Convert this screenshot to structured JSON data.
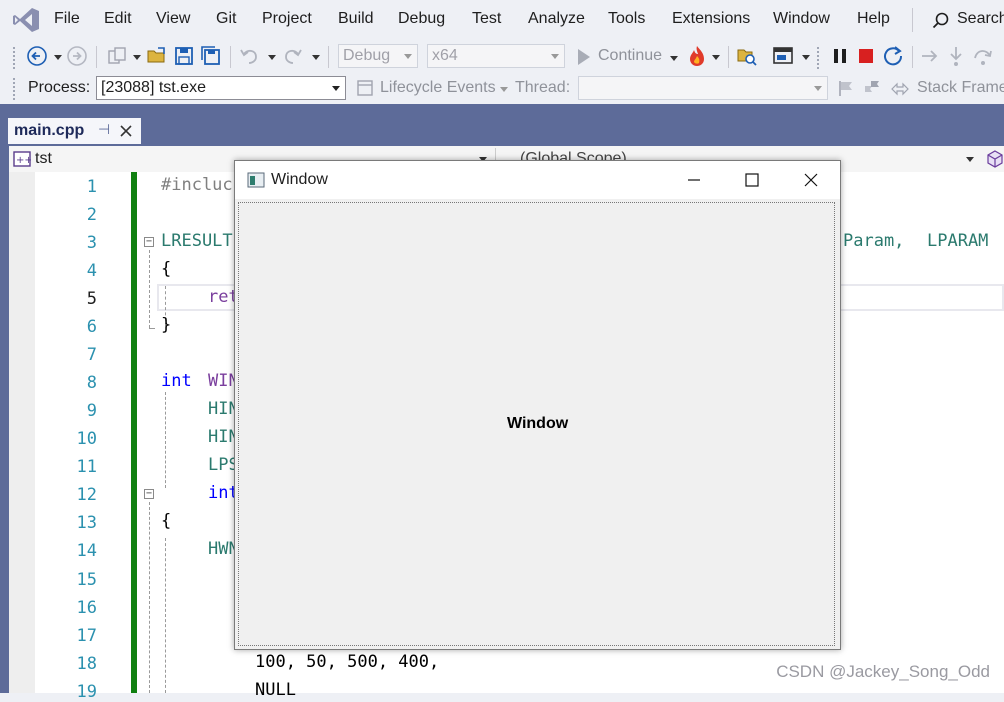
{
  "menu": {
    "items": [
      "File",
      "Edit",
      "View",
      "Git",
      "Project",
      "Build",
      "Debug",
      "Test",
      "Analyze",
      "Tools",
      "Extensions",
      "Window",
      "Help"
    ],
    "search_label": "Search"
  },
  "toolbar": {
    "config_value": "Debug",
    "platform_value": "x64",
    "continue_label": "Continue"
  },
  "process_bar": {
    "process_label": "Process:",
    "process_value": "[23088] tst.exe",
    "lifecycle_label": "Lifecycle Events",
    "thread_label": "Thread:",
    "stack_frame_label": "Stack Frame"
  },
  "tab": {
    "title": "main.cpp"
  },
  "editor_header": {
    "project_value": "tst",
    "scope_value": "(Global Scope)"
  },
  "editor": {
    "line_numbers": [
      "1",
      "2",
      "3",
      "4",
      "5",
      "6",
      "7",
      "8",
      "9",
      "10",
      "11",
      "12",
      "13",
      "14",
      "15",
      "16",
      "17",
      "18",
      "19"
    ],
    "current_line": "5",
    "lines": {
      "l1": "#incluc",
      "l3a": "LRESULT",
      "l3b": "Param, ",
      "l3c": "LPARAM",
      "l4": "{",
      "l5": "ret",
      "l6": "}",
      "l8a": "int",
      "l8b": "WIN",
      "l9": "HIN",
      "l10": "HIN",
      "l11": "LPS",
      "l12": "int",
      "l13": "{",
      "l14": "HWN",
      "l18": "100, 50, 500, 400,",
      "l19": "NULL"
    }
  },
  "app_window": {
    "title": "Window",
    "client_text": "Window"
  },
  "watermark": "CSDN @Jackey_Song_Odd",
  "colors": {
    "accent_band": "#5d6b99",
    "margin_green": "#108010",
    "keyword": "#0000ff",
    "type": "#2b7a6e",
    "line_number": "#2b91af"
  }
}
